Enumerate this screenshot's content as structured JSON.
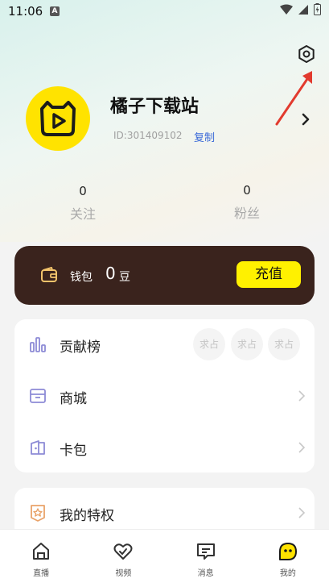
{
  "status_bar": {
    "time": "11:06",
    "notification_badge": "A"
  },
  "header": {
    "settings_icon": "gear-icon"
  },
  "profile": {
    "name": "橘子下载站",
    "id_text": "ID:301409102",
    "copy_label": "复制"
  },
  "stats": {
    "follow": {
      "count": "0",
      "label": "关注"
    },
    "fans": {
      "count": "0",
      "label": "粉丝"
    }
  },
  "wallet": {
    "label": "钱包",
    "amount": "0",
    "unit": "豆",
    "recharge_label": "充值"
  },
  "menu": {
    "contribution": {
      "label": "贡献榜",
      "slots": [
        "求占",
        "求占",
        "求占"
      ]
    },
    "mall": {
      "label": "商城"
    },
    "card_pack": {
      "label": "卡包"
    },
    "privileges": {
      "label": "我的特权"
    }
  },
  "tabbar": {
    "tabs": [
      {
        "label": "直播",
        "icon": "home-icon"
      },
      {
        "label": "视频",
        "icon": "heart-icon"
      },
      {
        "label": "消息",
        "icon": "message-icon"
      },
      {
        "label": "我的",
        "icon": "profile-face-icon"
      }
    ]
  },
  "colors": {
    "accent_yellow": "#fff100",
    "wallet_bg": "#3a231d",
    "link_blue": "#3b6ad8",
    "annotation_red": "#e23a2e"
  }
}
